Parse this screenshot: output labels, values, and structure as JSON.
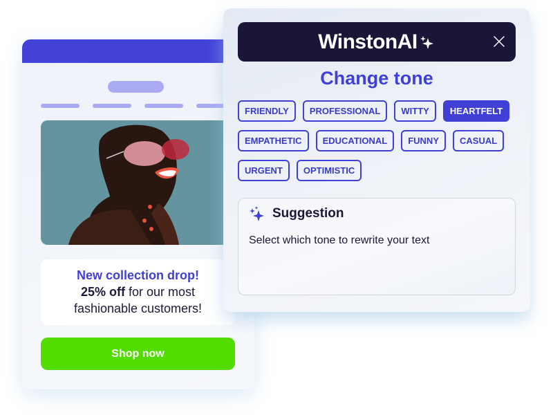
{
  "email": {
    "promo_title": "New collection drop!",
    "promo_bold": "25% off",
    "promo_rest_line1": " for our most",
    "promo_line2": "fashionable customers!",
    "shop_button": "Shop now",
    "image_alt": "Smiling woman wearing pink sunglasses"
  },
  "panel": {
    "logo": "WinstonAI",
    "title": "Change tone",
    "tones": [
      {
        "label": "FRIENDLY",
        "selected": false
      },
      {
        "label": "PROFESSIONAL",
        "selected": false
      },
      {
        "label": "WITTY",
        "selected": false
      },
      {
        "label": "HEARTFELT",
        "selected": true
      },
      {
        "label": "EMPATHETIC",
        "selected": false
      },
      {
        "label": "EDUCATIONAL",
        "selected": false
      },
      {
        "label": "FUNNY",
        "selected": false
      },
      {
        "label": "CASUAL",
        "selected": false
      },
      {
        "label": "URGENT",
        "selected": false
      },
      {
        "label": "OPTIMISTIC",
        "selected": false
      }
    ],
    "suggestion_title": "Suggestion",
    "suggestion_text": "Select which tone to rewrite your text"
  },
  "colors": {
    "brand_blue": "#4040d6",
    "dark_navy": "#1a1638",
    "cta_green": "#52dc00",
    "skeleton_lilac": "#aaaaf3"
  },
  "icons": {
    "logo_sparkle": "sparkle-icon",
    "close": "close-icon",
    "suggestion": "sparkles-icon"
  }
}
